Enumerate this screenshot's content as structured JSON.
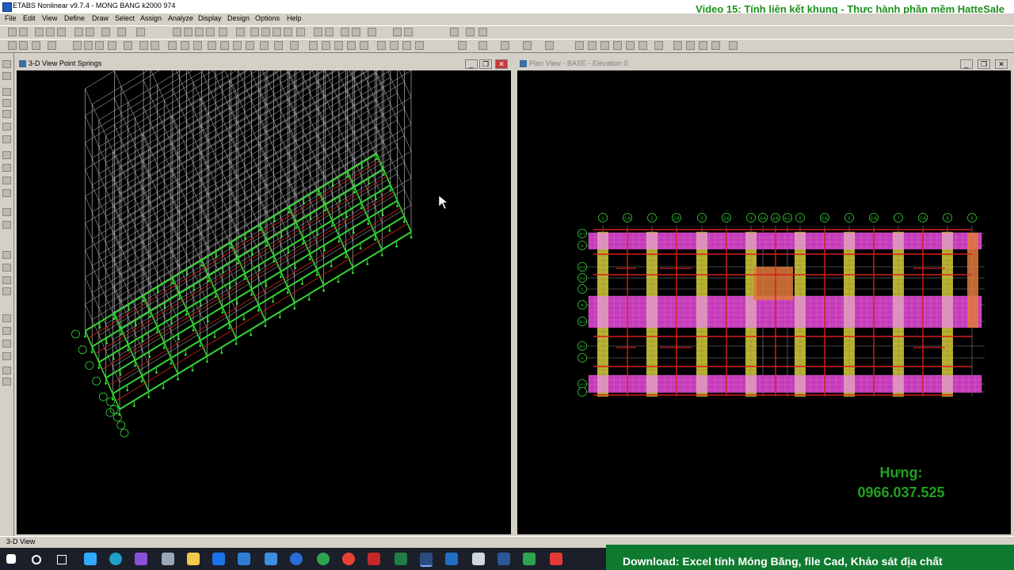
{
  "app": {
    "title": "ETABS Nonlinear v9.7.4 - MONG BANG k2000 974",
    "video_title": "Video 15: Tính liên kết khung - Thực hành phần mềm HatteSale"
  },
  "menu": [
    "File",
    "Edit",
    "View",
    "Define",
    "Draw",
    "Select",
    "Assign",
    "Analyze",
    "Display",
    "Design",
    "Options",
    "Help"
  ],
  "views": {
    "left": {
      "title": "3-D View  Point Springs"
    },
    "right": {
      "title": "Plan View - BASE - Elevation 0"
    }
  },
  "grid_labels": {
    "x": [
      "1",
      "1-A",
      "2",
      "2-A",
      "3",
      "3-A",
      "4",
      "4-A",
      "4-B",
      "4-C",
      "5",
      "5-A",
      "6",
      "6-A",
      "7",
      "7-A",
      "8",
      "9"
    ],
    "y": [
      "E-1",
      "D",
      "D-1",
      "D-2",
      "C",
      "B",
      "B-1",
      "B-2",
      "A",
      "A-1"
    ]
  },
  "status": {
    "left": "3-D View"
  },
  "contact": {
    "name": "Hưng:",
    "phone": "0966.037.525"
  },
  "promo": {
    "text": "Download: Excel tính Móng Băng, file Cad, Khảo sát địa chất"
  },
  "colors": {
    "strip_h": "#c43ab8",
    "strip_v": "#c8c038",
    "beam": "#d81e1e",
    "grid3d": "#cfcfcf",
    "spring": "#33d633"
  }
}
